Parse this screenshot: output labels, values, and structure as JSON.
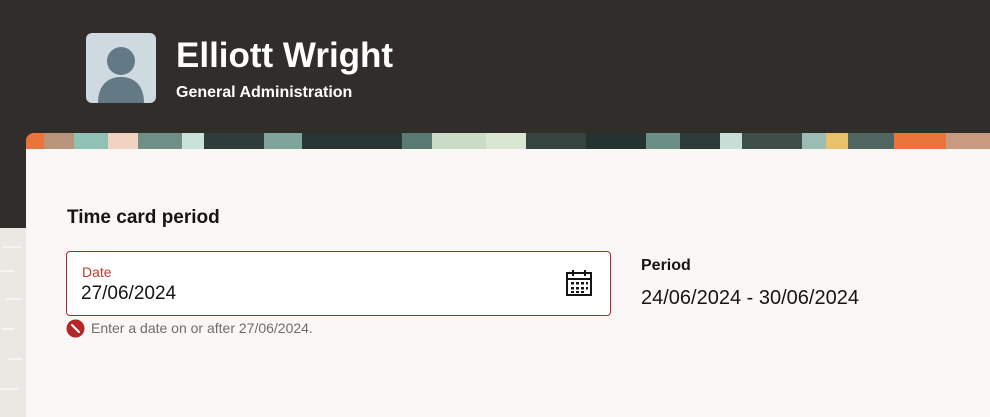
{
  "user": {
    "name": "Elliott Wright",
    "department": "General Administration"
  },
  "time_card": {
    "section_title": "Time card period",
    "date_label": "Date",
    "date_value": "27/06/2024",
    "error_message": "Enter a date on or after 27/06/2024.",
    "period_label": "Period",
    "period_value": "24/06/2024 - 30/06/2024"
  },
  "icons": {
    "avatar": "user-avatar-placeholder",
    "calendar": "calendar-icon",
    "error": "error-icon"
  },
  "colors": {
    "header_bg": "#312d2a",
    "card_bg": "#f9f8f6",
    "error": "#b3262a",
    "error_label": "#c13a2b",
    "text": "#161513",
    "muted_text": "#6f6c69"
  }
}
